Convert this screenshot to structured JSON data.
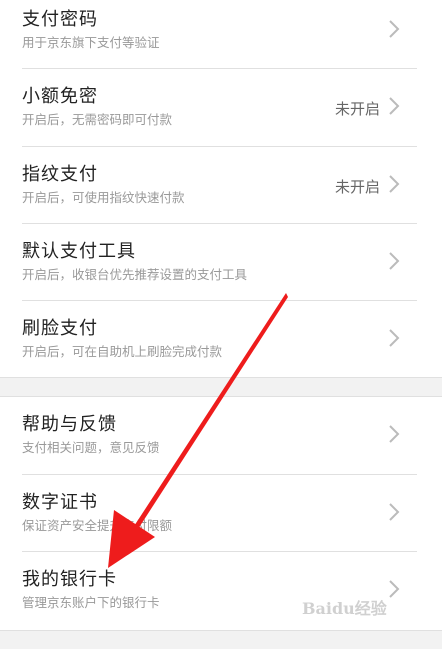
{
  "settings": {
    "items": [
      {
        "title": "支付密码",
        "subtitle": "用于京东旗下支付等验证",
        "status": ""
      },
      {
        "title": "小额免密",
        "subtitle": "开启后，无需密码即可付款",
        "status": "未开启"
      },
      {
        "title": "指纹支付",
        "subtitle": "开启后，可使用指纹快速付款",
        "status": "未开启"
      },
      {
        "title": "默认支付工具",
        "subtitle": "开启后，收银台优先推荐设置的支付工具",
        "status": ""
      },
      {
        "title": "刷脸支付",
        "subtitle": "开启后，可在自助机上刷脸完成付款",
        "status": ""
      }
    ],
    "items2": [
      {
        "title": "帮助与反馈",
        "subtitle": "支付相关问题，意见反馈",
        "status": ""
      },
      {
        "title": "数字证书",
        "subtitle": "保证资产安全提升支付限额",
        "status": ""
      },
      {
        "title": "我的银行卡",
        "subtitle": "管理京东账户下的银行卡",
        "status": ""
      }
    ]
  },
  "annotation": {
    "arrow_color": "#ee1c1c"
  },
  "watermark": {
    "text": "Baidu经验"
  },
  "icons": {
    "chevron": "chevron-right-icon"
  }
}
